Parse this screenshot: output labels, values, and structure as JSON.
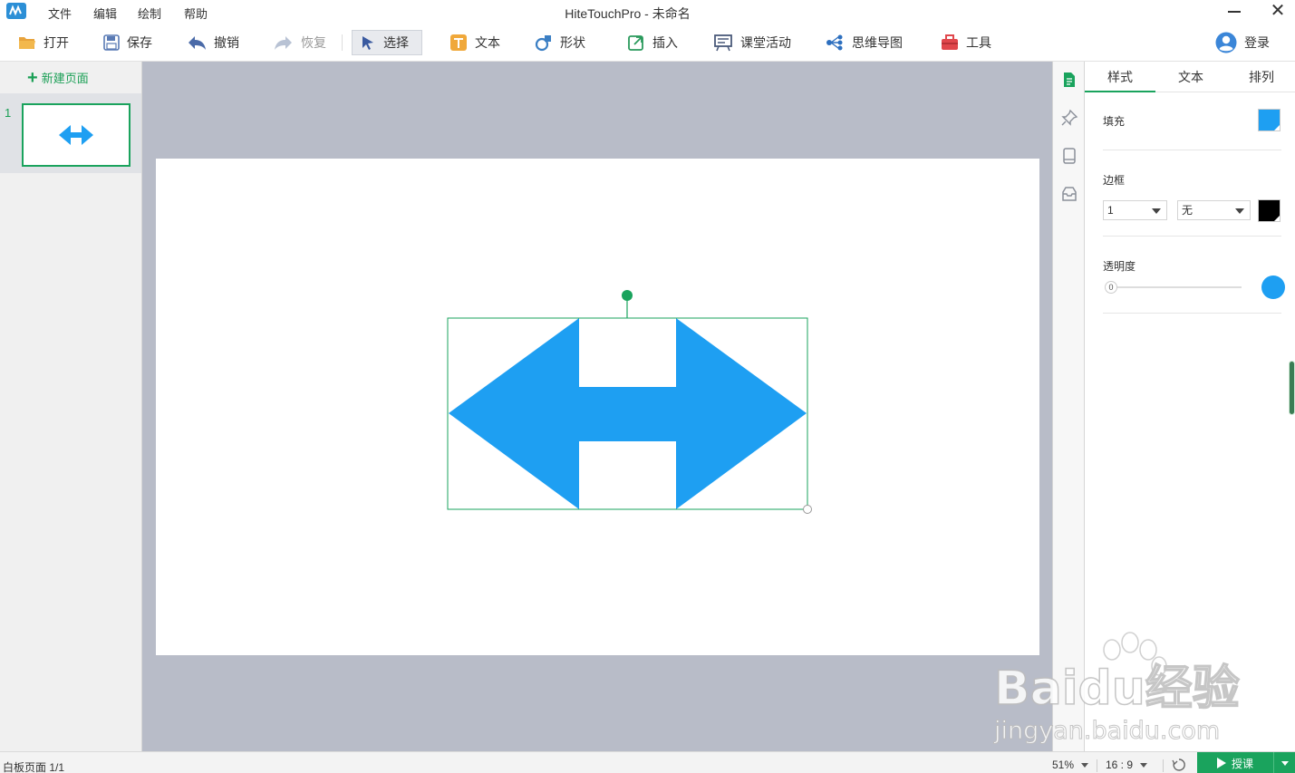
{
  "titlebar": {
    "menu": [
      "文件",
      "编辑",
      "绘制",
      "帮助"
    ],
    "title": "HiteTouchPro - 未命名",
    "close": "✕"
  },
  "toolbar": {
    "open": "打开",
    "save": "保存",
    "undo": "撤销",
    "redo": "恢复",
    "select": "选择",
    "text": "文本",
    "shape": "形状",
    "insert": "插入",
    "class_activity": "课堂活动",
    "mind_map": "思维导图",
    "tools": "工具",
    "login": "登录"
  },
  "left_panel": {
    "new_page": "新建页面",
    "pages": [
      {
        "number": "1"
      }
    ]
  },
  "right_panel": {
    "tabs": [
      "样式",
      "文本",
      "排列"
    ],
    "active_tab": "样式",
    "fill_label": "填充",
    "fill_color": "#1e9ff2",
    "border_label": "边框",
    "border_width": "1",
    "border_style": "无",
    "border_color": "#000000",
    "opacity_label": "透明度",
    "opacity_value": "0"
  },
  "canvas": {
    "shape": "double-arrow",
    "shape_color": "#1e9ff2",
    "selection_color": "#1aa35d"
  },
  "statusbar": {
    "page_info": "白板页面 1/1",
    "zoom": "51%",
    "ratio": "16 : 9",
    "teach": "授课"
  },
  "watermark": {
    "brand": "Baidu经验",
    "url": "jingyan.baidu.com"
  }
}
